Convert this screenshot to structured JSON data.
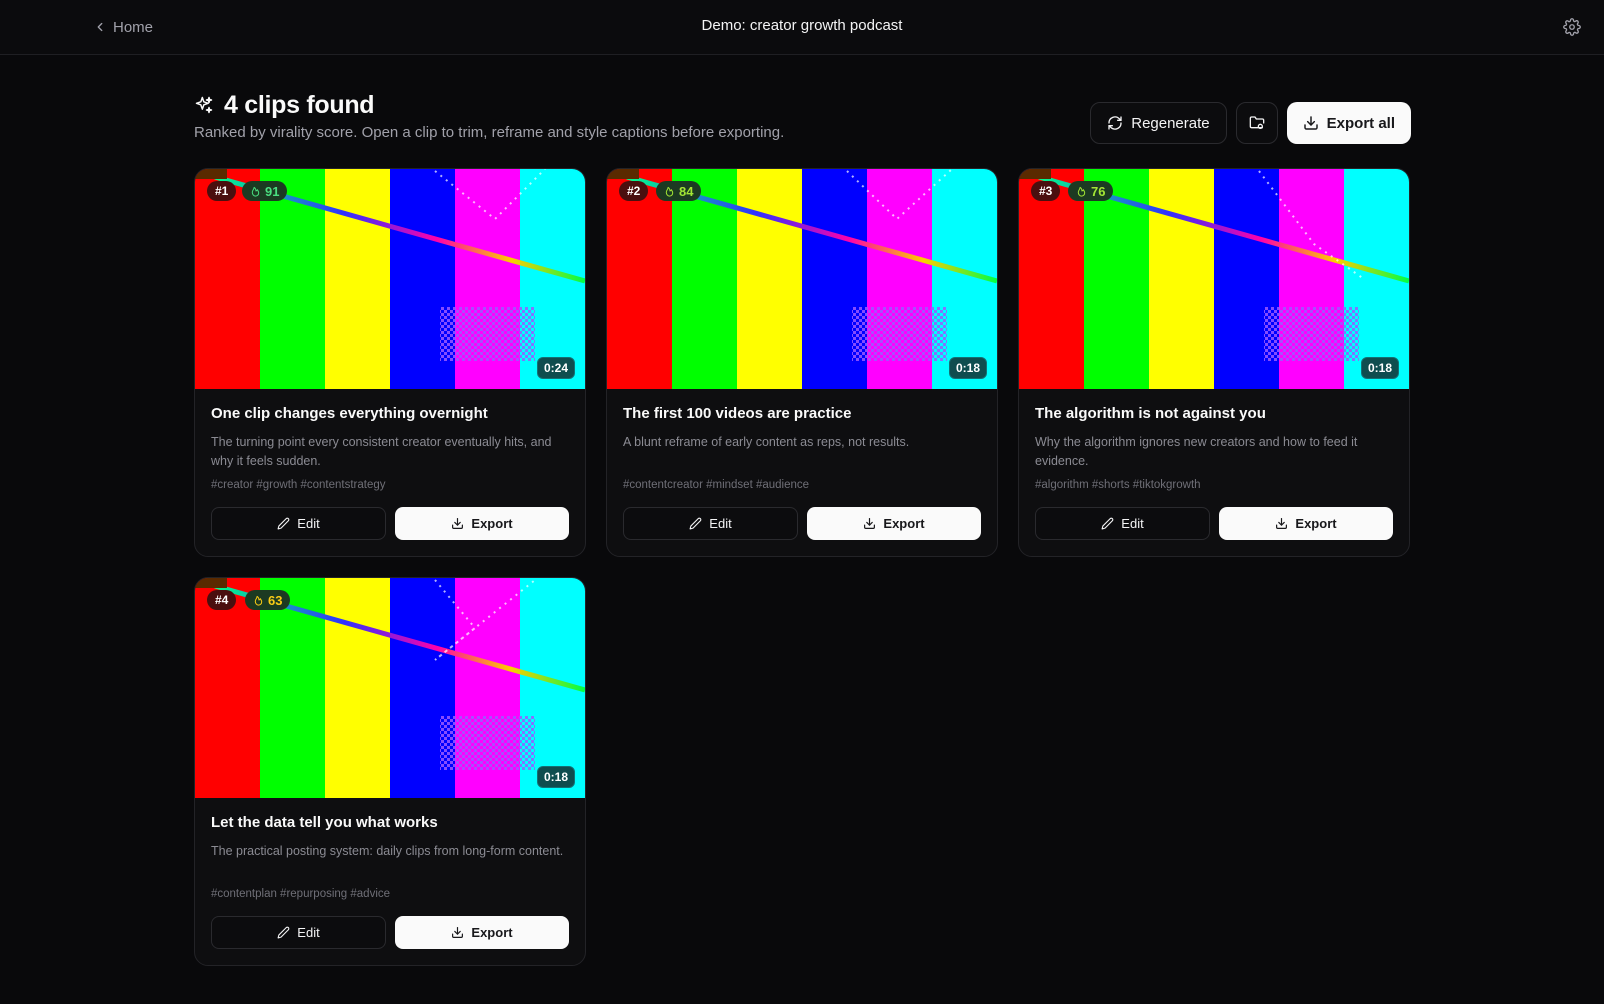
{
  "topbar": {
    "back_label": "Home",
    "title": "Demo: creator growth podcast"
  },
  "header": {
    "heading": "4 clips found",
    "subtitle": "Ranked by virality score. Open a clip to trim, reframe and style captions before exporting.",
    "regenerate_label": "Regenerate",
    "export_all_label": "Export all"
  },
  "card_labels": {
    "edit": "Edit",
    "export": "Export"
  },
  "colors": {
    "background": "#09090b",
    "score_high": "#4ade80",
    "score_mid": "#a3e635",
    "score_low": "#facc15"
  },
  "clips": [
    {
      "rank": "#1",
      "score": "91",
      "duration": "0:24",
      "title": "One clip changes everything overnight",
      "description": "The turning point every consistent creator eventually hits, and why it feels sudden.",
      "tags": "#creator #growth #contentstrategy"
    },
    {
      "rank": "#2",
      "score": "84",
      "duration": "0:18",
      "title": "The first 100 videos are practice",
      "description": "A blunt reframe of early content as reps, not results.",
      "tags": "#contentcreator #mindset #audience"
    },
    {
      "rank": "#3",
      "score": "76",
      "duration": "0:18",
      "title": "The algorithm is not against you",
      "description": "Why the algorithm ignores new creators and how to feed it evidence.",
      "tags": "#algorithm #shorts #tiktokgrowth"
    },
    {
      "rank": "#4",
      "score": "63",
      "duration": "0:18",
      "title": "Let the data tell you what works",
      "description": "The practical posting system: daily clips from long-form content.",
      "tags": "#contentplan #repurposing #advice"
    }
  ]
}
